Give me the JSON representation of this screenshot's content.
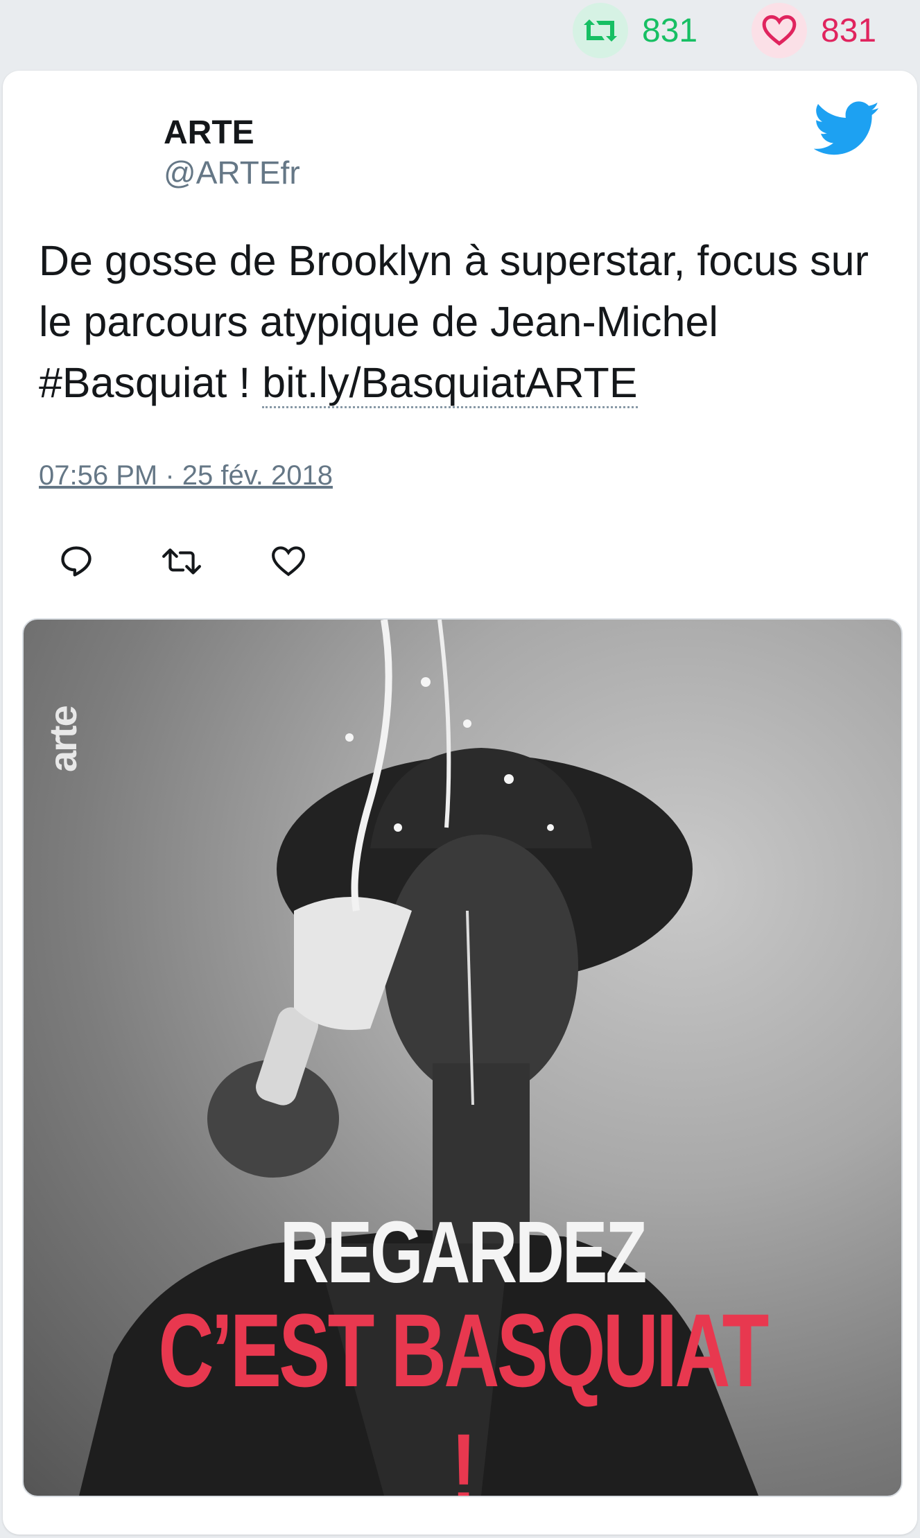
{
  "stats": {
    "retweet_count": "831",
    "like_count": "831",
    "retweet_icon": "retweet-icon",
    "like_icon": "heart-icon",
    "retweet_color": "#17bf63",
    "like_color": "#e0245e"
  },
  "tweet": {
    "author_name": "ARTE",
    "author_handle": "@ARTEfr",
    "text_prefix": "De gosse de Brooklyn à superstar, focus sur le parcours atypique de Jean-Michel #Basquiat ! ",
    "link_text": "bit.ly/BasquiatARTE",
    "timestamp": "07:56 PM · 25 fév. 2018",
    "brand_icon": "twitter-bird-icon",
    "brand_color": "#1da1f2"
  },
  "actions": {
    "reply_icon": "reply-icon",
    "retweet_icon": "retweet-icon",
    "like_icon": "heart-icon"
  },
  "media": {
    "logo_text": "arte",
    "headline_line1": "REGARDEZ",
    "headline_line2": "C’EST BASQUIAT !",
    "headline_accent": "#e8384f"
  }
}
